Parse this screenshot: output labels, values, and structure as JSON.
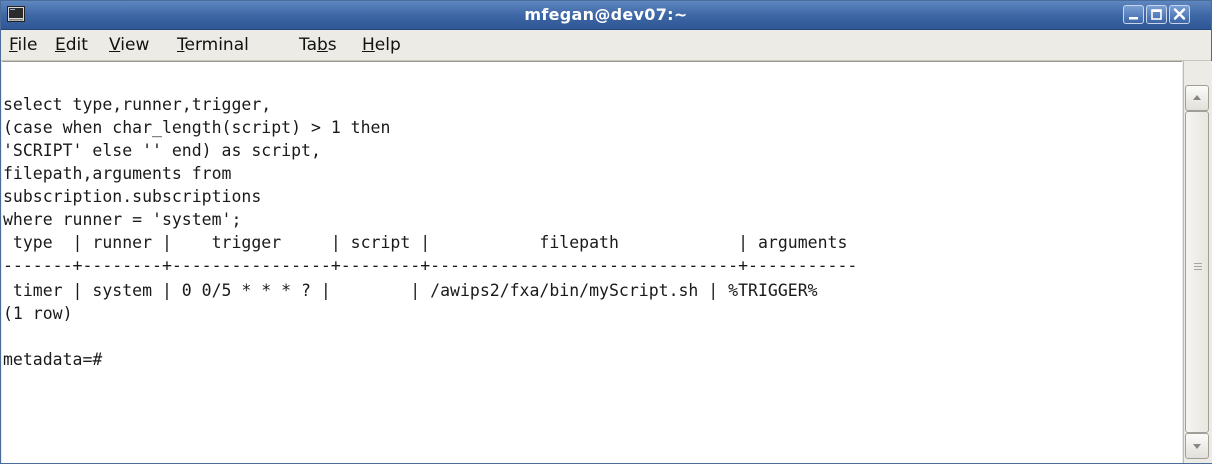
{
  "window": {
    "title": "mfegan@dev07:~",
    "icon": "terminal-icon",
    "controls": [
      "minimize-icon",
      "maximize-icon",
      "close-icon"
    ],
    "titlebar_color": "#3e67a6"
  },
  "menu": [
    {
      "before": "",
      "mnemonic": "F",
      "after": "ile"
    },
    {
      "before": "",
      "mnemonic": "E",
      "after": "dit"
    },
    {
      "before": "",
      "mnemonic": "V",
      "after": "iew"
    },
    {
      "before": "",
      "mnemonic": "T",
      "after": "erminal"
    },
    {
      "before": "Ta",
      "mnemonic": "b",
      "after": "s"
    },
    {
      "before": "",
      "mnemonic": "H",
      "after": "elp"
    }
  ],
  "terminal": {
    "lines": [
      "select type,runner,trigger,",
      "(case when char_length(script) > 1 then",
      "'SCRIPT' else '' end) as script,",
      "filepath,arguments from",
      "subscription.subscriptions",
      "where runner = 'system';",
      " type  | runner |    trigger     | script |           filepath            | arguments",
      "-------+--------+----------------+--------+-------------------------------+-----------",
      " timer | system | 0 0/5 * * * ? |        | /awips2/fxa/bin/myScript.sh | %TRIGGER%",
      "(1 row)",
      "",
      "metadata=#"
    ]
  }
}
